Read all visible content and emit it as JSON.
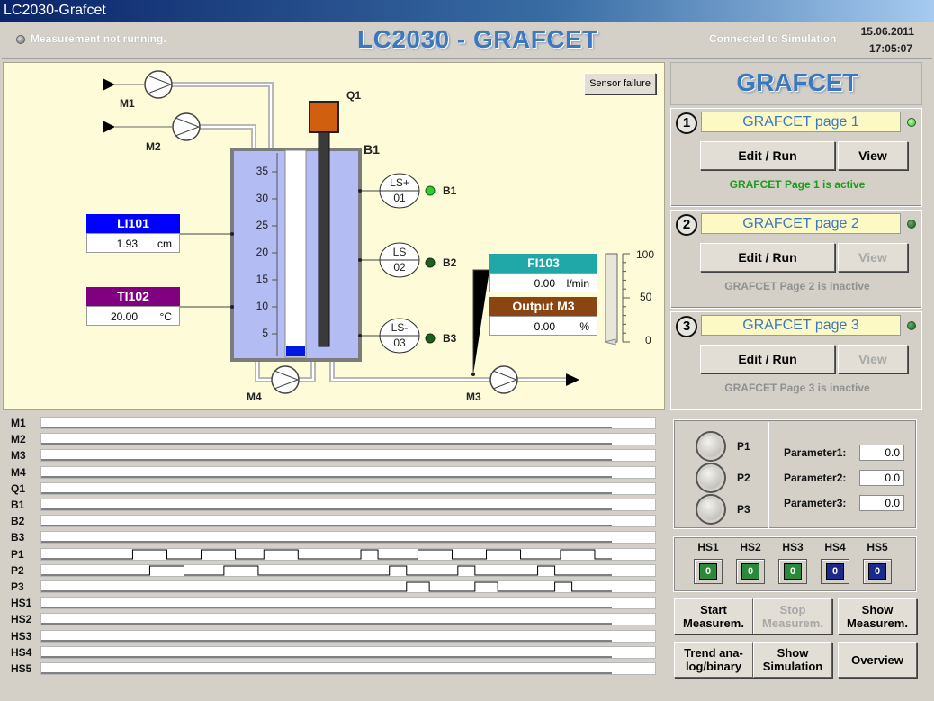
{
  "window": {
    "title": "LC2030-Grafcet"
  },
  "header": {
    "measurement_status": "Measurement not running.",
    "app_title": "LC2030 - GRAFCET",
    "connection_status": "Connected to Simulation",
    "date": "15.06.2011",
    "time": "17:05:07"
  },
  "process": {
    "sensor_failure_label": "Sensor failure",
    "pump_labels": {
      "m1": "M1",
      "m2": "M2",
      "m3": "M3",
      "m4": "M4"
    },
    "heater_label": "Q1",
    "tank_label": "B1",
    "tank_scale": [
      "35",
      "30",
      "25",
      "20",
      "15",
      "10",
      "5"
    ],
    "tank_level_fraction": 0.05,
    "level_sensors": [
      {
        "line1": "LS+",
        "line2": "01",
        "name": "B1",
        "state": "on"
      },
      {
        "line1": "LS",
        "line2": "02",
        "name": "B2",
        "state": "off"
      },
      {
        "line1": "LS-",
        "line2": "03",
        "name": "B3",
        "state": "off"
      }
    ],
    "li101": {
      "tag": "LI101",
      "value": "1.93",
      "unit": "cm",
      "color": "#0000ff"
    },
    "ti102": {
      "tag": "TI102",
      "value": "20.00",
      "unit": "°C",
      "color": "#800080"
    },
    "fi103": {
      "tag": "FI103",
      "value": "0.00",
      "unit": "l/min",
      "color": "#20a8a8"
    },
    "output_m3": {
      "tag": "Output M3",
      "value": "0.00",
      "unit": "%",
      "color": "#8b4513"
    },
    "gauge": {
      "ticks": [
        "100",
        "50",
        "0"
      ],
      "level_percent": 0
    }
  },
  "signals": {
    "names": [
      "M1",
      "M2",
      "M3",
      "M4",
      "Q1",
      "B1",
      "B2",
      "B3",
      "P1",
      "P2",
      "P3",
      "HS1",
      "HS2",
      "HS3",
      "HS4",
      "HS5"
    ],
    "traces": {
      "P1": [
        [
          0,
          0
        ],
        [
          0.16,
          1
        ],
        [
          0.22,
          0
        ],
        [
          0.28,
          1
        ],
        [
          0.34,
          0
        ],
        [
          0.39,
          1
        ],
        [
          0.45,
          0
        ],
        [
          0.56,
          1
        ],
        [
          0.59,
          0
        ],
        [
          0.66,
          1
        ],
        [
          0.72,
          0
        ],
        [
          0.78,
          1
        ],
        [
          0.84,
          0
        ],
        [
          0.91,
          1
        ],
        [
          0.97,
          0
        ]
      ],
      "P2": [
        [
          0,
          0
        ],
        [
          0.19,
          1
        ],
        [
          0.25,
          0
        ],
        [
          0.32,
          1
        ],
        [
          0.38,
          0
        ],
        [
          0.61,
          1
        ],
        [
          0.64,
          0
        ],
        [
          0.73,
          1
        ],
        [
          0.76,
          0
        ],
        [
          0.87,
          1
        ],
        [
          0.9,
          0
        ]
      ],
      "P3": [
        [
          0,
          0
        ],
        [
          0.64,
          1
        ],
        [
          0.68,
          0
        ],
        [
          0.76,
          1
        ],
        [
          0.8,
          0
        ],
        [
          0.9,
          1
        ],
        [
          0.93,
          0
        ]
      ]
    }
  },
  "grafcet": {
    "title": "GRAFCET",
    "pages": [
      {
        "num": "1",
        "name": "GRAFCET page 1",
        "edit_label": "Edit / Run",
        "view_label": "View",
        "status": "GRAFCET Page 1 is active",
        "active": true
      },
      {
        "num": "2",
        "name": "GRAFCET page 2",
        "edit_label": "Edit / Run",
        "view_label": "View",
        "status": "GRAFCET Page 2 is inactive",
        "active": false
      },
      {
        "num": "3",
        "name": "GRAFCET page 3",
        "edit_label": "Edit / Run",
        "view_label": "View",
        "status": "GRAFCET Page 3 is inactive",
        "active": false
      }
    ]
  },
  "pswitches": {
    "labels": [
      "P1",
      "P2",
      "P3"
    ],
    "params": [
      {
        "label": "Parameter1:",
        "value": "0.0"
      },
      {
        "label": "Parameter2:",
        "value": "0.0"
      },
      {
        "label": "Parameter3:",
        "value": "0.0"
      }
    ]
  },
  "hs": [
    {
      "label": "HS1",
      "value": "0",
      "color": "green"
    },
    {
      "label": "HS2",
      "value": "0",
      "color": "green"
    },
    {
      "label": "HS3",
      "value": "0",
      "color": "green"
    },
    {
      "label": "HS4",
      "value": "0",
      "color": "blue"
    },
    {
      "label": "HS5",
      "value": "0",
      "color": "blue"
    }
  ],
  "buttons": {
    "start": "Start\nMeasurem.",
    "stop": "Stop\nMeasurem.",
    "show_meas": "Show\nMeasurem.",
    "trend": "Trend ana-\nlog/binary",
    "show_sim": "Show\nSimulation",
    "overview": "Overview"
  }
}
